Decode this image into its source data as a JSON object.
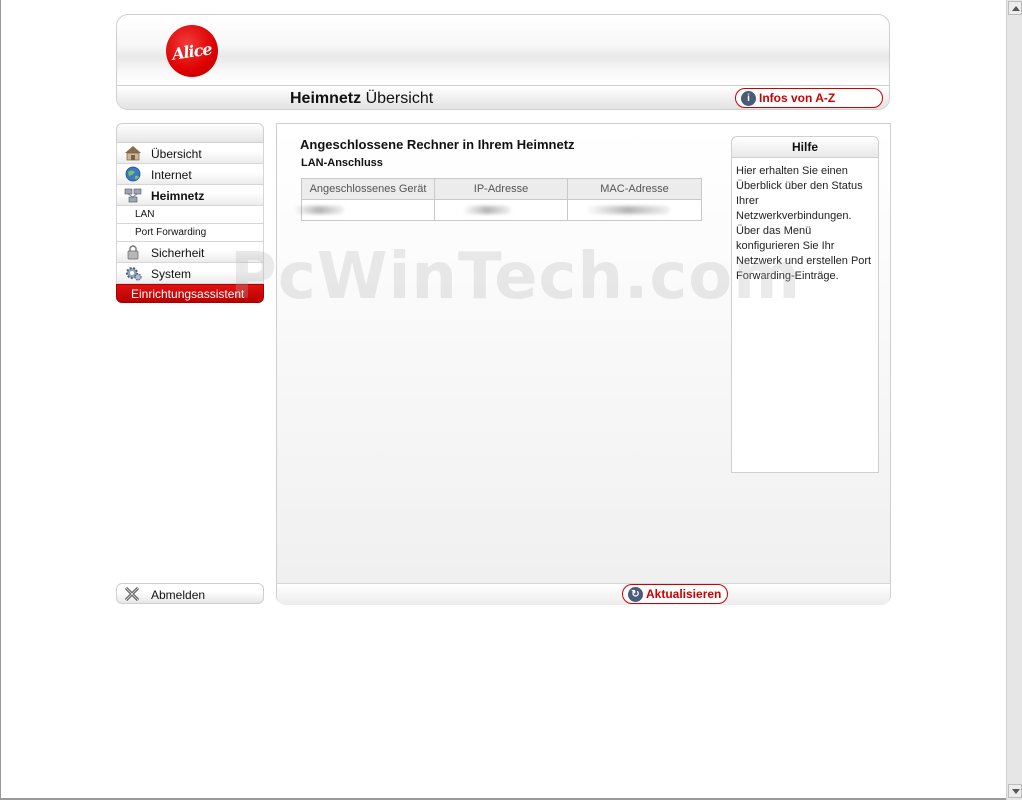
{
  "header": {
    "logo_text": "Alice",
    "title_bold": "Heimnetz",
    "title_rest": "Übersicht",
    "infos_button": "Infos von A-Z"
  },
  "sidebar": {
    "items": [
      {
        "label": "Übersicht",
        "icon": "house-icon"
      },
      {
        "label": "Internet",
        "icon": "globe-icon"
      },
      {
        "label": "Heimnetz",
        "icon": "network-icon",
        "active": true
      }
    ],
    "subitems": [
      {
        "label": "LAN"
      },
      {
        "label": "Port Forwarding"
      }
    ],
    "items2": [
      {
        "label": "Sicherheit",
        "icon": "lock-icon"
      },
      {
        "label": "System",
        "icon": "gear-icon"
      }
    ],
    "wizard": "Einrichtungsassistent",
    "logout": "Abmelden"
  },
  "content": {
    "title": "Angeschlossene Rechner in Ihrem Heimnetz",
    "subtitle": "LAN-Anschluss",
    "table": {
      "headers": [
        "Angeschlossenes Gerät",
        "IP-Adresse",
        "MAC-Adresse"
      ]
    },
    "refresh_button": "Aktualisieren"
  },
  "help": {
    "title": "Hilfe",
    "text": "Hier erhalten Sie einen Überblick über den Status Ihrer Netzwerkverbindungen. Über das Menü konfigurieren Sie Ihr Netzwerk und erstellen Port Forwarding-Einträge."
  },
  "watermark": "PcWinTech.com",
  "colors": {
    "brand_red": "#cc0000",
    "border": "#cfcfcf"
  }
}
